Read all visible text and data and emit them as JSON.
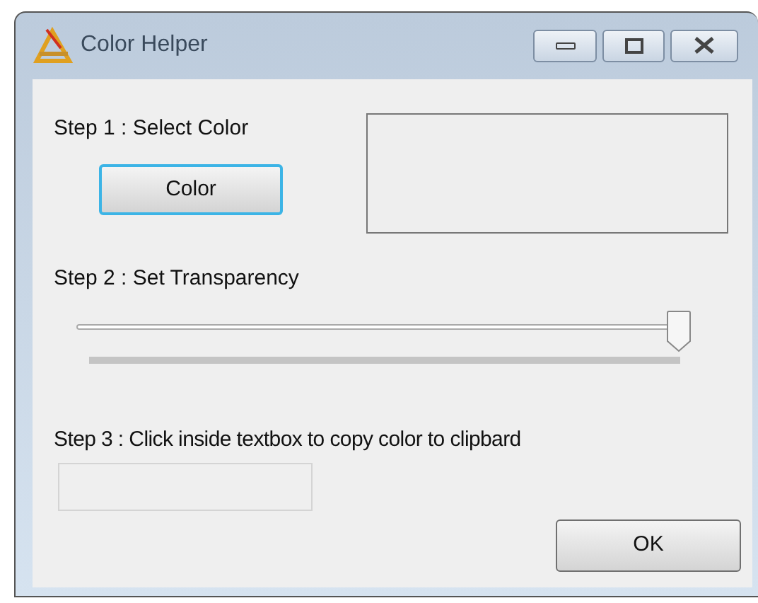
{
  "window": {
    "title": "Color Helper"
  },
  "step1": {
    "label": "Step 1 : Select Color",
    "button": "Color"
  },
  "step2": {
    "label": "Step 2 : Set Transparency",
    "slider": {
      "level": 1.0
    }
  },
  "step3": {
    "label": "Step 3 : Click inside textbox to copy color to clipbard",
    "field": {
      "disabled": true
    }
  },
  "buttons": [
    "OK"
  ]
}
